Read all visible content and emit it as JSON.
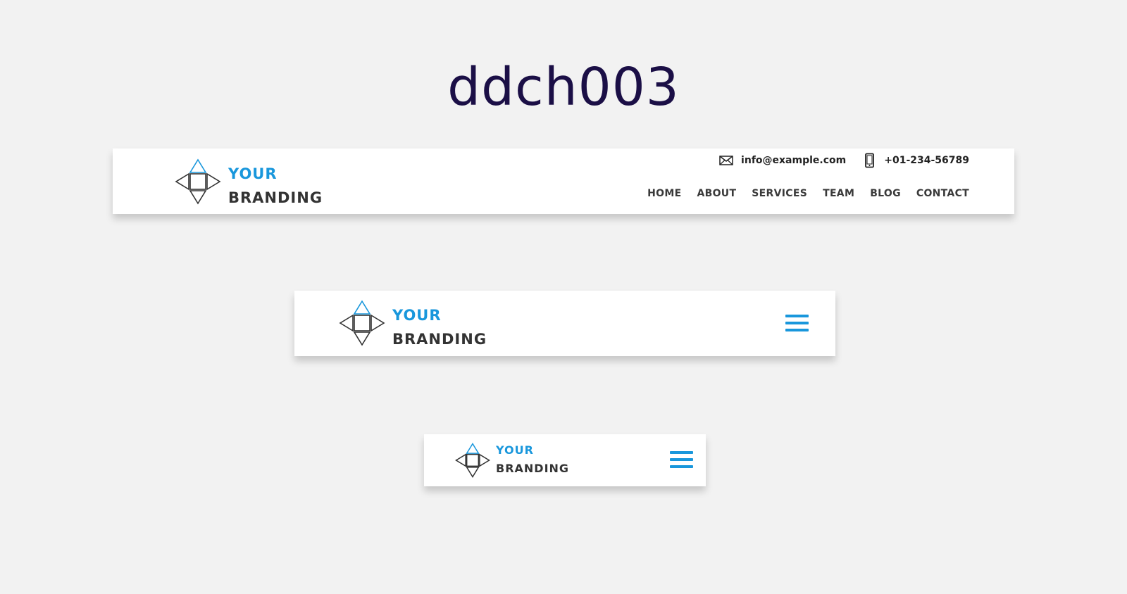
{
  "page": {
    "title": "ddch003"
  },
  "brand": {
    "line1": "YOUR",
    "line2": "BRANDING",
    "logo_icon": "diamond-triangles-logo",
    "accent_color": "#1997dc",
    "text_color": "#333333"
  },
  "desktop_header": {
    "contact": {
      "email_icon": "envelope-icon",
      "email": "info@example.com",
      "phone_icon": "mobile-phone-icon",
      "phone": "+01-234-56789"
    },
    "nav": [
      "HOME",
      "ABOUT",
      "SERVICES",
      "TEAM",
      "BLOG",
      "CONTACT"
    ]
  },
  "tablet_header": {
    "menu_icon": "hamburger-menu-icon"
  },
  "mobile_header": {
    "menu_icon": "hamburger-menu-icon"
  }
}
